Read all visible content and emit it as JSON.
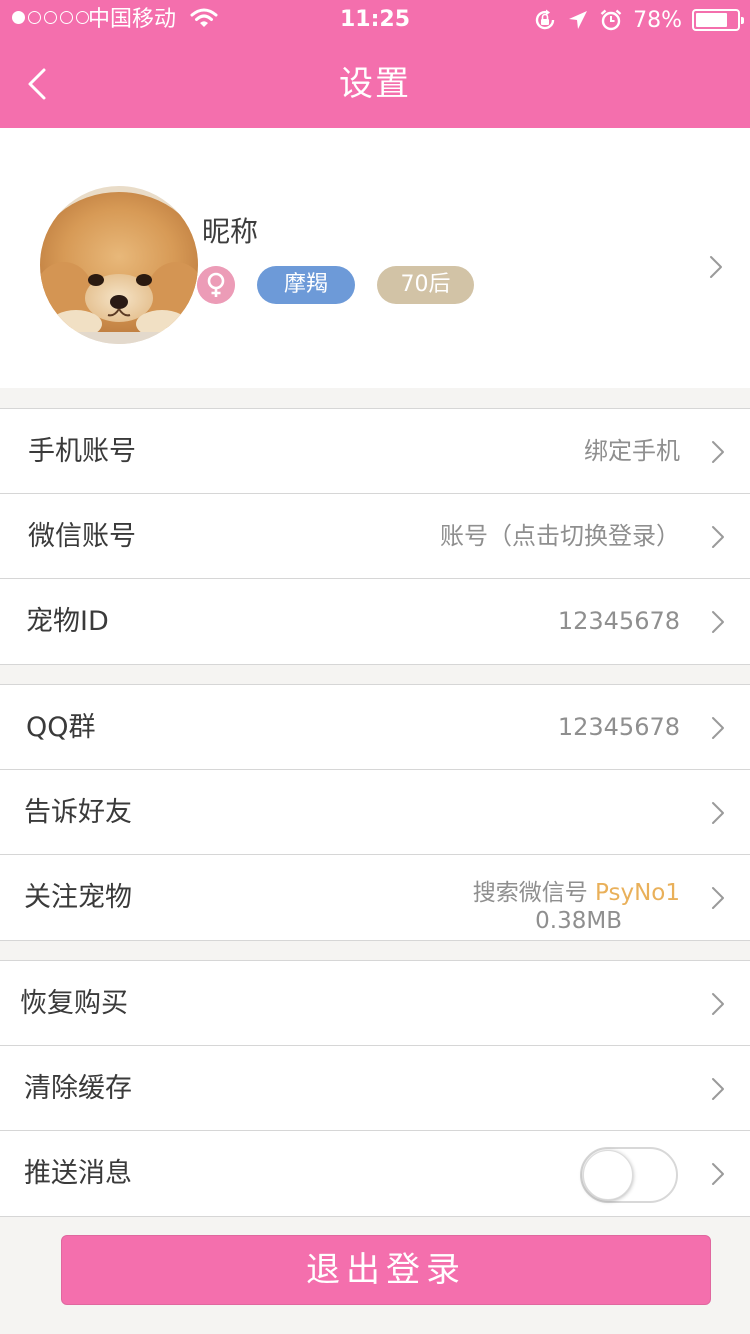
{
  "status_bar": {
    "carrier": "中国移动",
    "time": "11:25",
    "battery_percent": "78%",
    "battery_level": 0.78,
    "signal_dots": 5,
    "signal_active": 1
  },
  "nav": {
    "title": "设置",
    "back_icon": "chevron-left-icon"
  },
  "profile": {
    "nickname": "昵称",
    "gender_icon": "female-icon",
    "zodiac_tag": "摩羯",
    "era_tag": "70后"
  },
  "groups": [
    {
      "rows": [
        {
          "label": "手机账号",
          "value": "绑定手机"
        },
        {
          "label": "微信账号",
          "value": "账号（点击切换登录）"
        },
        {
          "label": "宠物ID",
          "value": "12345678"
        }
      ]
    },
    {
      "rows": [
        {
          "label": "QQ群",
          "value": "12345678"
        },
        {
          "label": "告诉好友",
          "value": ""
        },
        {
          "label": "关注宠物",
          "value_prefix": "搜索微信号",
          "value_accent": "PsyNo1",
          "value_sub": "0.38MB"
        }
      ]
    },
    {
      "rows": [
        {
          "label": "恢复购买",
          "value": ""
        },
        {
          "label": "清除缓存",
          "value": ""
        },
        {
          "label": "推送消息",
          "toggle_on": false
        }
      ]
    }
  ],
  "logout_label": "退出登录",
  "colors": {
    "primary": "#f46fad",
    "zodiac_tag": "#6d9ad8",
    "era_tag": "#d2c3a6",
    "gender_badge": "#ec9cb7",
    "accent_text": "#e9b05a"
  }
}
